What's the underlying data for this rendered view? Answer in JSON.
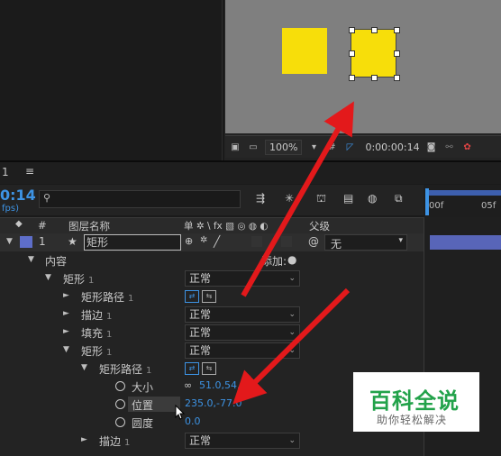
{
  "viewer": {
    "zoom": "100%",
    "timecode": "0:00:00:14"
  },
  "timeline": {
    "tab_label": "1",
    "tab_menu": "≡",
    "current_time": "0:14",
    "fps_label": "fps)",
    "search_placeholder": "",
    "ruler_labels": [
      "00f",
      "05f"
    ]
  },
  "columns": {
    "label": "🏷",
    "number": "#",
    "layer_name": "图层名称",
    "switches": "单 ✲ \\ fx ▧ ◎ ◍ ◐",
    "parent": "父级"
  },
  "layer": {
    "index": "1",
    "name": "矩形",
    "parent_value": "无",
    "label_color": "#5e6ec9"
  },
  "tree": {
    "contents": "内容",
    "add_label": "添加:",
    "rect1": "矩形",
    "rect1_num": "1",
    "rect_path1": "矩形路径",
    "rect_path1_num": "1",
    "stroke1": "描边",
    "stroke1_num": "1",
    "fill1": "填充",
    "fill1_num": "1",
    "rect1b": "矩形",
    "rect1b_num": "1",
    "rect_path1b": "矩形路径",
    "rect_path1b_num": "1",
    "size_label": "大小",
    "size_value": "51.0,54.0",
    "position_label": "位置",
    "position_value": "235.0,-77.0",
    "roundness_label": "圆度",
    "roundness_value": "0.0",
    "stroke_b": "描边",
    "stroke_b_num": "1"
  },
  "blend_modes": {
    "rect1": "正常",
    "stroke1": "正常",
    "fill1": "正常",
    "rect1b": "正常",
    "stroke_b": "正常"
  },
  "watermark": {
    "title": "百科全说",
    "subtitle": "助你轻松解决"
  },
  "colors": {
    "accent_blue": "#3d93e4",
    "shape_yellow": "#f7de0a",
    "arrow_red": "#e3191b"
  }
}
